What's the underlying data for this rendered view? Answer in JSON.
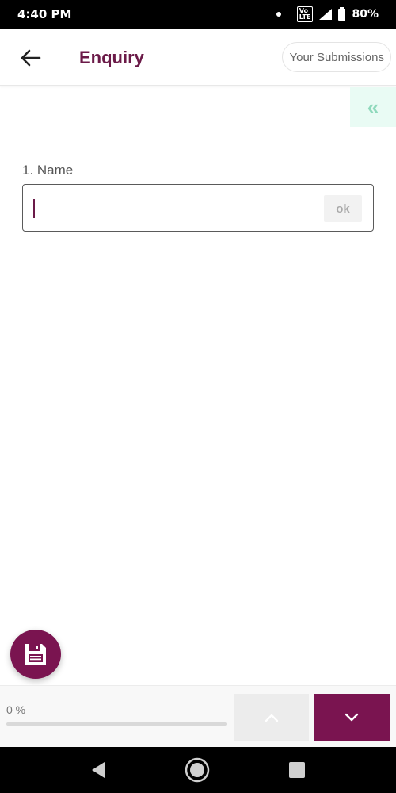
{
  "status_bar": {
    "time": "4:40 PM",
    "volte": "VoLTE",
    "battery": "80%"
  },
  "header": {
    "title": "Enquiry",
    "submissions_label": "Your Submissions",
    "back_icon": "arrow-left-icon"
  },
  "collapse_tab": {
    "glyph": "«",
    "icon": "double-chevron-left-icon"
  },
  "question": {
    "label": "1. Name",
    "value": "",
    "ok_label": "ok"
  },
  "progress": {
    "label": "0 %",
    "percent": 0
  },
  "colors": {
    "brand": "#6b1a48",
    "accent": "#7a1450",
    "collapse_tab_bg": "#e9fbf4",
    "collapse_tab_fg": "#8fd9bc"
  }
}
